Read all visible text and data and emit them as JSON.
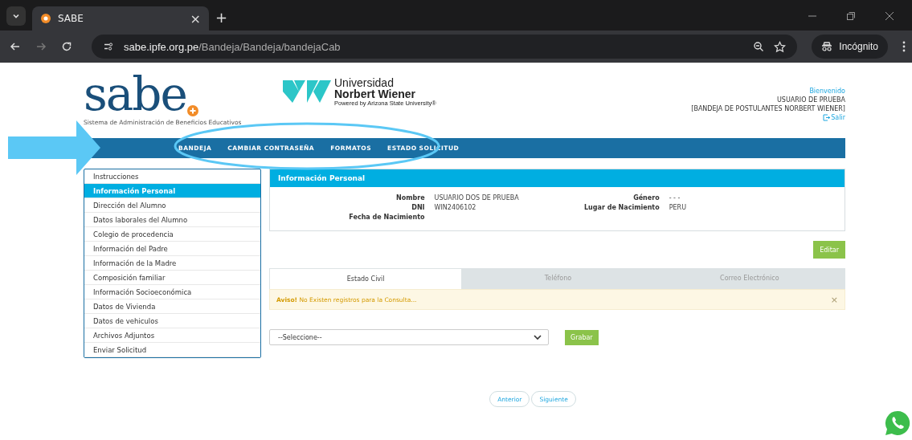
{
  "browser": {
    "tab_title": "SABE",
    "tab_close": "×",
    "new_tab": "+",
    "url_host": "sabe.ipfe.org.pe",
    "url_path": "/Bandeja/Bandeja/bandejaCab",
    "incognito": "Incógnito"
  },
  "header": {
    "logo": "sabe",
    "logo_subtitle": "Sistema de Administración de Beneficios Educativos",
    "university": [
      "Universidad",
      "Norbert Wiener"
    ],
    "university_tagline": "Powered by Arizona State University®",
    "greeting": "Bienvenido",
    "user": "USUARIO DE PRUEBA",
    "tray": "[BANDEJA DE POSTULANTES NORBERT WIENER]",
    "logout": "Salir"
  },
  "nav": [
    "BANDEJA",
    "CAMBIAR CONTRASEÑA",
    "FORMATOS",
    "ESTADO SOLICITUD"
  ],
  "sidebar": {
    "items": [
      {
        "label": "Instrucciones",
        "selected": false
      },
      {
        "label": "Información Personal",
        "selected": true
      },
      {
        "label": "Dirección del Alumno",
        "selected": false
      },
      {
        "label": "Datos laborales del Alumno",
        "selected": false
      },
      {
        "label": "Colegio de procedencia",
        "selected": false
      },
      {
        "label": "Información del Padre",
        "selected": false
      },
      {
        "label": "Información de la Madre",
        "selected": false
      },
      {
        "label": "Composición familiar",
        "selected": false
      },
      {
        "label": "Información Socioeconómica",
        "selected": false
      },
      {
        "label": "Datos de Vivienda",
        "selected": false
      },
      {
        "label": "Datos de vehiculos",
        "selected": false
      },
      {
        "label": "Archivos Adjuntos",
        "selected": false
      },
      {
        "label": "Enviar Solicitud",
        "selected": false
      }
    ]
  },
  "panel": {
    "title": "Información Personal",
    "fields_left": [
      {
        "label": "Nombre",
        "value": "USUARIO DOS DE PRUEBA"
      },
      {
        "label": "DNI",
        "value": "WIN2406102"
      },
      {
        "label": "Fecha de Nacimiento"
      }
    ],
    "fields_right": [
      {
        "label": "Género",
        "value": "- - -"
      },
      {
        "label": "Lugar de Nacimiento",
        "value": "PERU"
      }
    ]
  },
  "edit_button": "Editar",
  "tabs": [
    {
      "label": "Estado Civil",
      "selected": true
    },
    {
      "label": "Teléfono",
      "selected": false
    },
    {
      "label": "Correo Electrónico",
      "selected": false
    }
  ],
  "alert": {
    "title": "Aviso!",
    "message": "No Existen registros para la Consulta...",
    "close": "×"
  },
  "select": {
    "value": "--Seleccione--"
  },
  "save_button": "Grabar",
  "pager": [
    "Anterior",
    "Siguiente"
  ]
}
